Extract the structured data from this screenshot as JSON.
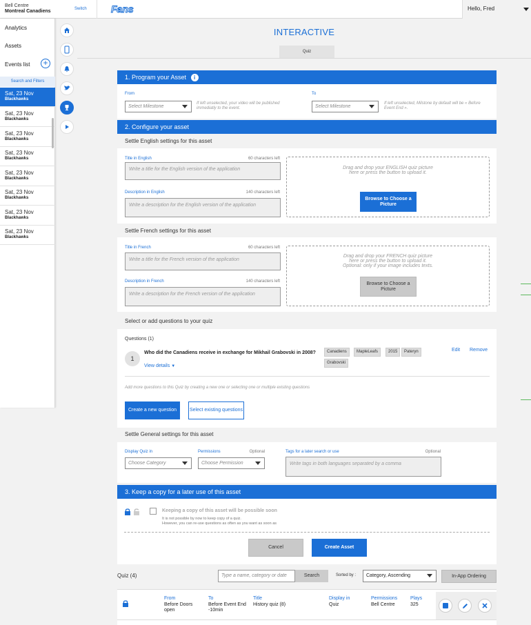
{
  "header": {
    "venue": "Bell Centre",
    "team": "Montreal Canadiens",
    "switch_label": "Switch",
    "logo_text": "Fans",
    "greeting": "Hello, Fred"
  },
  "sidebar": {
    "analytics": "Analytics",
    "assets": "Assets",
    "events_list": "Events list",
    "search_filters": "Search and Filters",
    "events": [
      {
        "date": "Sat, 23 Nov",
        "team": "Blackhawks"
      },
      {
        "date": "Sat, 23 Nov",
        "team": "Blackhawks"
      },
      {
        "date": "Sat, 23 Nov",
        "team": "Blackhawks"
      },
      {
        "date": "Sat, 23 Nov",
        "team": "Blackhawks"
      },
      {
        "date": "Sat, 23 Nov",
        "team": "Blackhawks"
      },
      {
        "date": "Sat, 23 Nov",
        "team": "Blackhawks"
      },
      {
        "date": "Sat, 23 Nov",
        "team": "Blackhawks"
      },
      {
        "date": "Sat, 23 Nov",
        "team": "Blackhawks"
      }
    ]
  },
  "page": {
    "title": "INTERACTIVE",
    "tab": "Quiz"
  },
  "section1": {
    "title": "1. Program your Asset",
    "from_label": "From",
    "from_placeholder": "Select Milestone",
    "from_hint": "If left unselected, your video will be published immediatly to the event.",
    "to_label": "To",
    "to_placeholder": "Select Milestone",
    "to_hint": "If left unselected, Milstone by default will be « Before Event End »."
  },
  "section2": {
    "title": "2. Configure your asset",
    "english_heading": "Settle English settings for this asset",
    "en_title_label": "Title in English",
    "en_title_count": "60 characters left",
    "en_title_placeholder": "Write a title for the English version of the application",
    "en_desc_label": "Description in English",
    "en_desc_count": "140 characters left",
    "en_desc_placeholder": "Write a description for the English version of the application",
    "en_drop_line1": "Drag and drop your ENGLISH quiz picture",
    "en_drop_line2": "here or press the button to upload it.",
    "en_browse": "Browse to Choose a Picture",
    "french_heading": "Settle French settings for this asset",
    "fr_title_label": "Title in French",
    "fr_title_count": "60 characters left",
    "fr_title_placeholder": "Write a title for the French version of the application",
    "fr_desc_label": "Description in French",
    "fr_desc_count": "140 characters left",
    "fr_desc_placeholder": "Write a description for the French version of the application",
    "fr_drop_line1": "Drag and drop your FRENCH quiz picture",
    "fr_drop_line2": "here or press the button to upload it.",
    "fr_drop_line3": "Optional: only if your image includes texts.",
    "fr_browse": "Browse to Choose a Picture",
    "questions_heading": "Select or add questions to your quiz",
    "questions_label": "Questions (1)",
    "question_number": "1",
    "question_text": "Who did the Canadiens receive in exchange for Mikhail Grabovski in 2008?",
    "view_details": "View details",
    "question_tags": [
      "Canadiens",
      "MapleLeafs",
      "2015",
      "Pateryn",
      "Grabovski"
    ],
    "edit": "Edit",
    "remove": "Remove",
    "add_more_hint": "Add more questions to this Quiz by creating a new one or selecting one or multiple existing questions",
    "create_question": "Create a new question",
    "select_existing": "Select existing questions",
    "general_heading": "Settle General settings for this asset",
    "display_label": "Display Quiz in",
    "display_placeholder": "Choose Category",
    "permissions_label": "Permissions",
    "permissions_optional": "Optional",
    "permissions_placeholder": "Choose Permission",
    "tags_label": "Tags for a later search or use",
    "tags_optional": "Optional",
    "tags_placeholder": "Write tags in both languages separated by a comma"
  },
  "section3": {
    "title": "3. Keep a copy for a later use of this asset",
    "keep_label": "Keeping a copy of this asset will be possible soon",
    "keep_note1": "It is not possible by now to keep copy of a quiz.",
    "keep_note2": "However, you can re-use questions as often as you want as soon as",
    "cancel": "Cancel",
    "create": "Create Asset"
  },
  "list": {
    "title": "Quiz (4)",
    "search_placeholder": "Type a name, category or date",
    "search_btn": "Search",
    "sorted_by": "Sorted by :",
    "sort_value": "Category, Ascending",
    "inapp": "In-App Ordering",
    "row": {
      "from_h": "From",
      "from_v": "Before Doors open",
      "to_h": "To",
      "to_v": "Before Event End -10min",
      "title_h": "Title",
      "title_v": "History quiz (8)",
      "display_h": "Display in",
      "display_v": "Quiz",
      "perm_h": "Permissions",
      "perm_v": "Bell Centre",
      "plays_h": "Plays",
      "plays_v": "325"
    }
  },
  "colors": {
    "accent": "#1b6fd6",
    "panel": "#ffffff",
    "background": "#f2f2f2"
  }
}
